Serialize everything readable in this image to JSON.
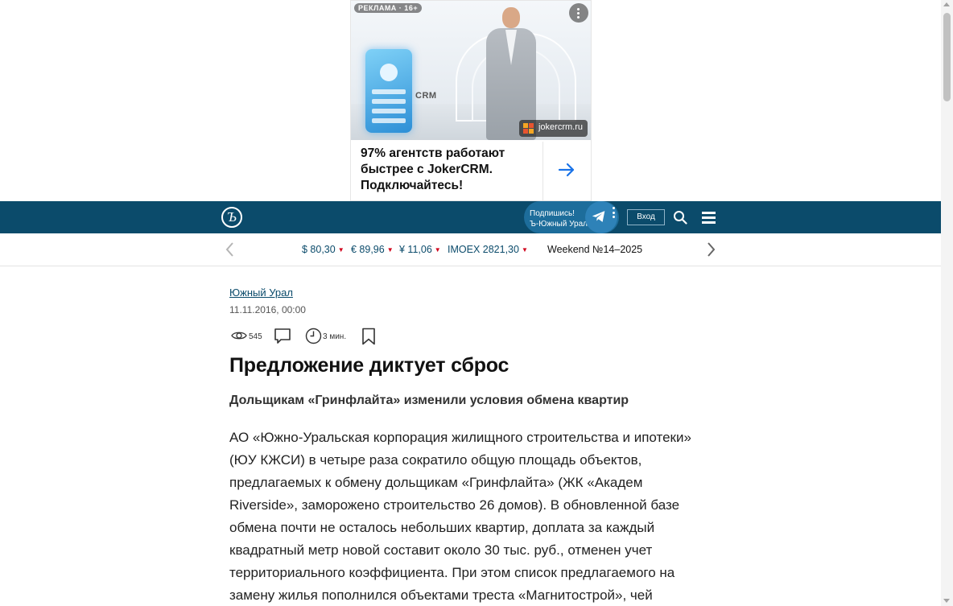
{
  "ad": {
    "label": "РЕКЛАМА · 16+",
    "image_text": "CRM",
    "domain": "jokercrm.ru",
    "text": "97% агентств работают быстрее с JokerCRM. Подключайтесь!",
    "icons": [
      "more-icon",
      "arrow-right-icon"
    ]
  },
  "header": {
    "logo": "Ъ",
    "subscribe_line1": "Подпишись!",
    "subscribe_line2": "Ъ-Южный Урал",
    "login": "Вход",
    "icons": [
      "telegram-icon",
      "search-icon",
      "menu-icon"
    ],
    "colors": {
      "header_bg": "#0b4b6b",
      "subscribe_bg": "#1d6d9b"
    }
  },
  "rates": {
    "items": [
      {
        "label": "$ 80,30"
      },
      {
        "label": "€ 89,96"
      },
      {
        "label": "¥ 11,06"
      },
      {
        "label": "IMOEX 2821,30"
      }
    ],
    "down_marker": "▼",
    "weekend": "Weekend №14–2025",
    "colors": {
      "down": "#d0021b"
    }
  },
  "article": {
    "rubric": "Южный Урал",
    "date": "11.11.2016, 00:00",
    "views": "545",
    "read_time": "3 мин.",
    "title": "Предложение диктует сброс",
    "subtitle": "Дольщикам «Гринфлайта» изменили условия обмена квартир",
    "body": "АО «Южно-Уральская корпорация жилищного строительства и ипотеки» (ЮУ КЖСИ) в четыре раза сократило общую площадь объектов, предлагаемых к обмену дольщикам «Гринфлайта» (ЖК «Академ Riverside», заморожено строительство 26 домов). В обновленной базе обмена почти не осталось небольших квартир, доплата за каждый квадратный метр новой составит около 30 тыс. руб., отменен учет территориального коэффициента. При этом список предлагаемого на замену жилья пополнился объектами треста «Магнитострой», чей"
  }
}
